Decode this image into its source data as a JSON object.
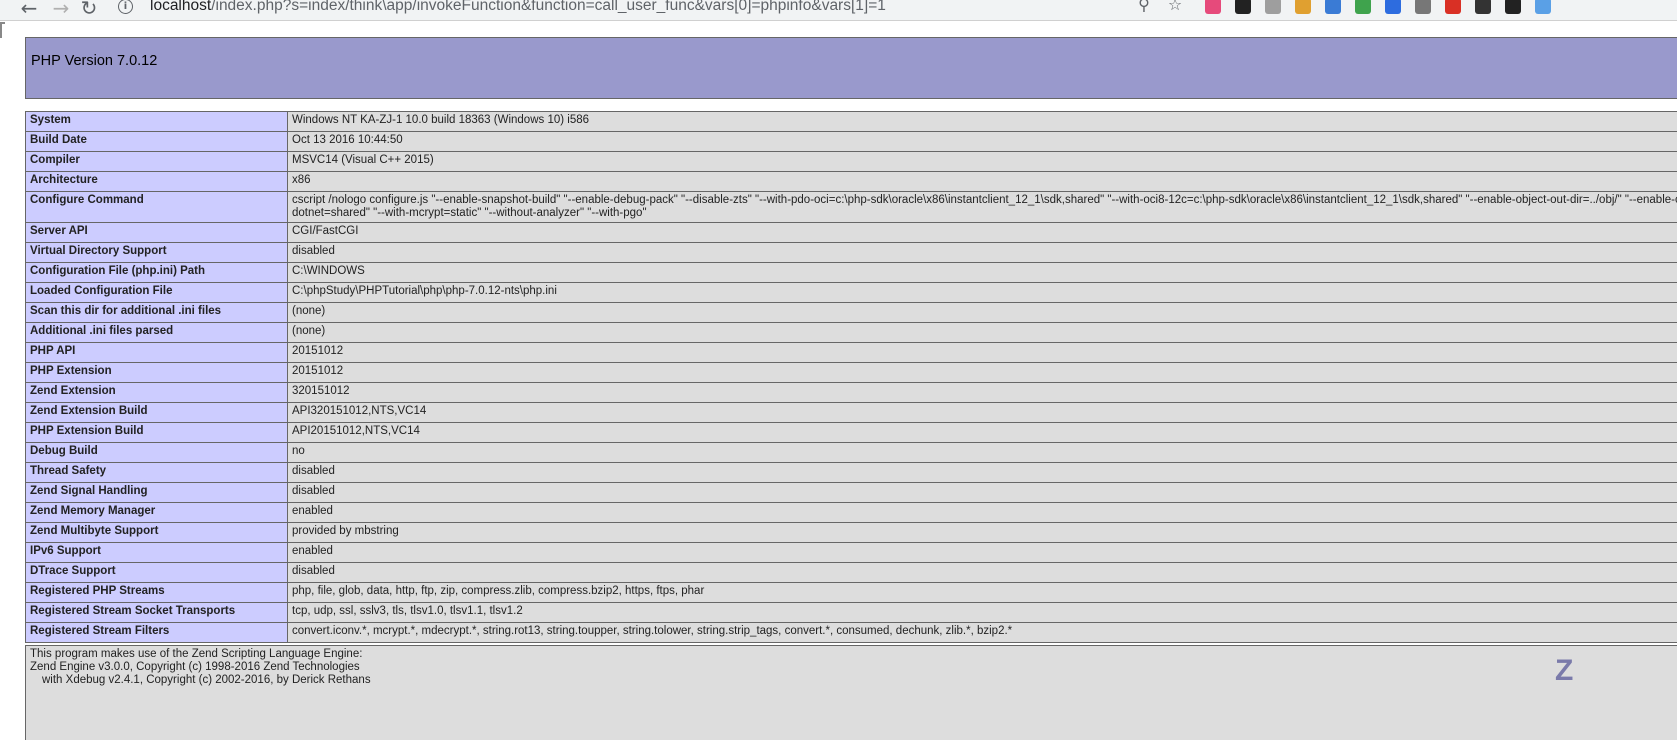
{
  "browser": {
    "url_host": "localhost",
    "url_path": "/index.php?s=index/think\\app/invokeFunction&function=call_user_func&vars[0]=phpinfo&vars[1]=1",
    "back_icon": "arrow-left-icon",
    "forward_icon": "arrow-right-icon",
    "reload_icon": "reload-icon",
    "info_glyph": "i",
    "zoom_icon": "magnifier-icon",
    "bookmark_icon": "star-icon",
    "extensions": [
      {
        "name": "color-picker-extension-icon",
        "color": "#e64a7b"
      },
      {
        "name": "dark-x-extension-icon",
        "color": "#222222"
      },
      {
        "name": "grey-ring-extension-icon",
        "color": "#9e9e9e"
      },
      {
        "name": "cookie-extension-icon",
        "color": "#e0a030"
      },
      {
        "name": "globe-extension-icon",
        "color": "#3a7bd5"
      },
      {
        "name": "green-gear-extension-icon",
        "color": "#3fa34d"
      },
      {
        "name": "lambda-extension-icon",
        "color": "#2d6cdf"
      },
      {
        "name": "settings-extension-icon",
        "color": "#777777"
      },
      {
        "name": "red-flag-extension-icon",
        "color": "#d93025"
      },
      {
        "name": "calendar-extension-icon",
        "color": "#333333"
      },
      {
        "name": "search-extension-icon",
        "color": "#222222"
      },
      {
        "name": "image-extension-icon",
        "color": "#5aa0e6"
      }
    ]
  },
  "phpinfo": {
    "header_title": "PHP Version 7.0.12",
    "rows": [
      {
        "key": "System",
        "value": "Windows NT KA-ZJ-1 10.0 build 18363 (Windows 10) i586"
      },
      {
        "key": "Build Date",
        "value": "Oct 13 2016 10:44:50"
      },
      {
        "key": "Compiler",
        "value": "MSVC14 (Visual C++ 2015)"
      },
      {
        "key": "Architecture",
        "value": "x86"
      },
      {
        "key": "Configure Command",
        "value": "cscript /nologo configure.js \"--enable-snapshot-build\" \"--enable-debug-pack\" \"--disable-zts\" \"--with-pdo-oci=c:\\php-sdk\\oracle\\x86\\instantclient_12_1\\sdk,shared\" \"--with-oci8-12c=c:\\php-sdk\\oracle\\x86\\instantclient_12_1\\sdk,shared\" \"--enable-object-out-dir=../obj/\" \"--enable-com-dotnet=shared\" \"--with-mcrypt=static\" \"--without-analyzer\" \"--with-pgo\""
      },
      {
        "key": "Server API",
        "value": "CGI/FastCGI"
      },
      {
        "key": "Virtual Directory Support",
        "value": "disabled"
      },
      {
        "key": "Configuration File (php.ini) Path",
        "value": "C:\\WINDOWS"
      },
      {
        "key": "Loaded Configuration File",
        "value": "C:\\phpStudy\\PHPTutorial\\php\\php-7.0.12-nts\\php.ini"
      },
      {
        "key": "Scan this dir for additional .ini files",
        "value": "(none)"
      },
      {
        "key": "Additional .ini files parsed",
        "value": "(none)"
      },
      {
        "key": "PHP API",
        "value": "20151012"
      },
      {
        "key": "PHP Extension",
        "value": "20151012"
      },
      {
        "key": "Zend Extension",
        "value": "320151012"
      },
      {
        "key": "Zend Extension Build",
        "value": "API320151012,NTS,VC14"
      },
      {
        "key": "PHP Extension Build",
        "value": "API20151012,NTS,VC14"
      },
      {
        "key": "Debug Build",
        "value": "no"
      },
      {
        "key": "Thread Safety",
        "value": "disabled"
      },
      {
        "key": "Zend Signal Handling",
        "value": "disabled"
      },
      {
        "key": "Zend Memory Manager",
        "value": "enabled"
      },
      {
        "key": "Zend Multibyte Support",
        "value": "provided by mbstring"
      },
      {
        "key": "IPv6 Support",
        "value": "enabled"
      },
      {
        "key": "DTrace Support",
        "value": "disabled"
      },
      {
        "key": "Registered PHP Streams",
        "value": "php, file, glob, data, http, ftp, zip, compress.zlib, compress.bzip2, https, ftps, phar"
      },
      {
        "key": "Registered Stream Socket Transports",
        "value": "tcp, udp, ssl, sslv3, tls, tlsv1.0, tlsv1.1, tlsv1.2"
      },
      {
        "key": "Registered Stream Filters",
        "value": "convert.iconv.*, mcrypt.*, mdecrypt.*, string.rot13, string.toupper, string.tolower, string.strip_tags, convert.*, consumed, dechunk, zlib.*, bzip2.*"
      }
    ],
    "credits": {
      "line1": "This program makes use of the Zend Scripting Language Engine:",
      "line2": "Zend Engine v3.0.0, Copyright (c) 1998-2016 Zend Technologies",
      "line3": "with Xdebug v2.4.1, Copyright (c) 2002-2016, by Derick Rethans",
      "logo_text": "Z"
    }
  }
}
